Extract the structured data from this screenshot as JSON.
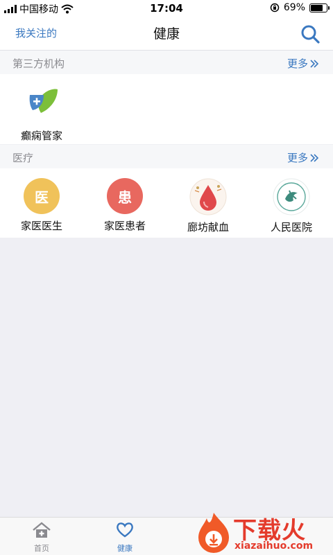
{
  "status_bar": {
    "carrier": "中国移动",
    "time": "17:04",
    "battery": "69%",
    "battery_level": 0.69
  },
  "nav": {
    "left_link": "我关注的",
    "title": "健康"
  },
  "sections": [
    {
      "title": "第三方机构",
      "more": "更多",
      "items": [
        {
          "label": "癫痫管家",
          "icon": "leaf-plus-icon"
        }
      ]
    },
    {
      "title": "医疗",
      "more": "更多",
      "items": [
        {
          "label": "家医医生",
          "icon": "doctor-icon",
          "glyph": "医",
          "color": "#f0c25a"
        },
        {
          "label": "家医患者",
          "icon": "patient-icon",
          "glyph": "患",
          "color": "#e8685f"
        },
        {
          "label": "廊坊献血",
          "icon": "blood-drop-icon"
        },
        {
          "label": "人民医院",
          "icon": "hospital-logo-icon"
        }
      ]
    }
  ],
  "tabbar": [
    {
      "label": "首页",
      "icon": "home-icon",
      "color": "#8a8a8f"
    },
    {
      "label": "健康",
      "icon": "heart-icon",
      "color": "#3a78c0"
    }
  ],
  "watermark": {
    "title": "下载火",
    "url": "xiazaihuo.com"
  }
}
